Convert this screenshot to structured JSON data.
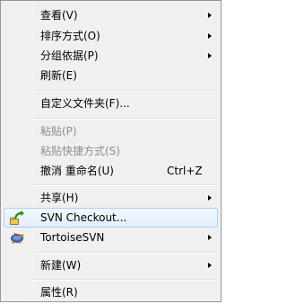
{
  "menu": {
    "items": [
      {
        "label": "查看(V)"
      },
      {
        "label": "排序方式(O)"
      },
      {
        "label": "分组依据(P)"
      },
      {
        "label": "刷新(E)"
      },
      {
        "label": "自定义文件夹(F)..."
      },
      {
        "label": "粘贴(P)"
      },
      {
        "label": "粘贴快捷方式(S)"
      },
      {
        "label": "撤消 重命名(U)",
        "shortcut": "Ctrl+Z"
      },
      {
        "label": "共享(H)"
      },
      {
        "label": "SVN Checkout..."
      },
      {
        "label": "TortoiseSVN"
      },
      {
        "label": "新建(W)"
      },
      {
        "label": "属性(R)"
      }
    ]
  },
  "icons": {
    "svn_checkout": "svn-checkout-icon",
    "tortoisesvn": "tortoise-icon"
  }
}
